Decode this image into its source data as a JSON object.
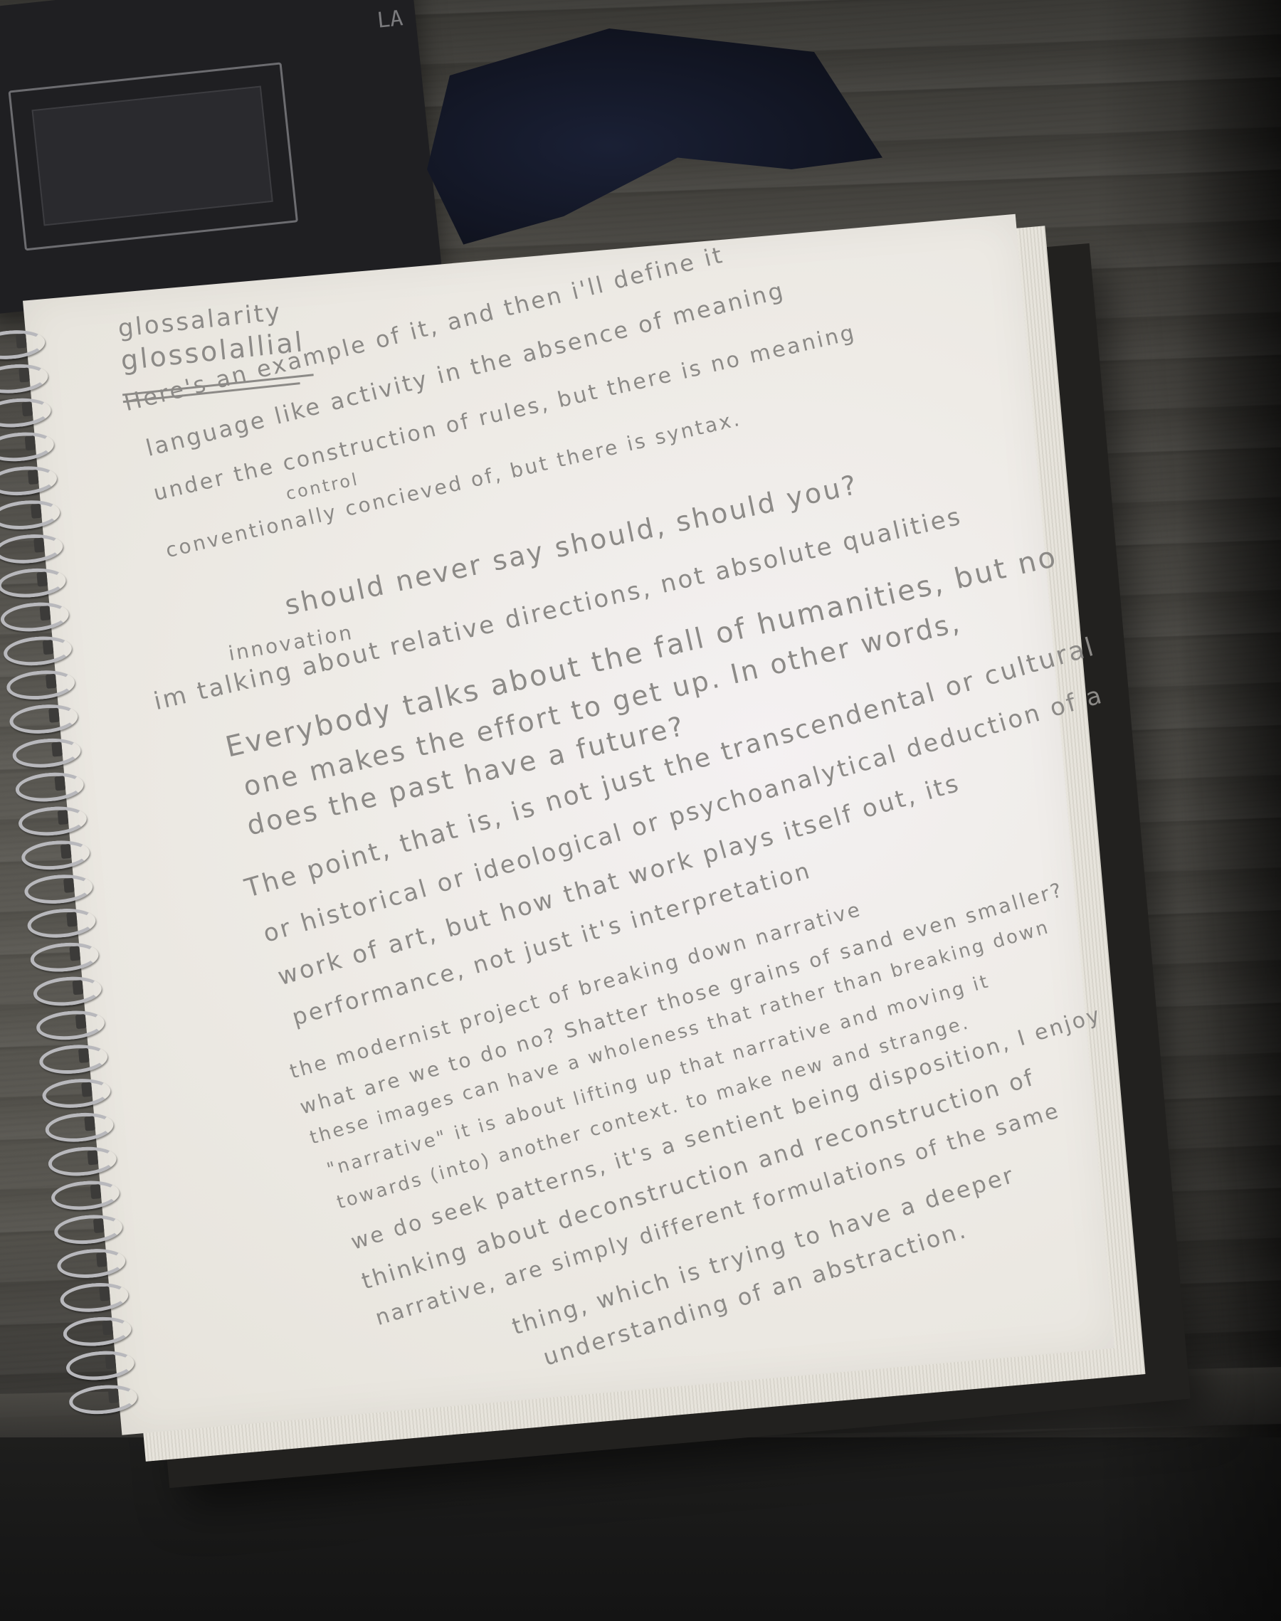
{
  "scene": {
    "description_objects": [
      "wooden-table",
      "spiral-notebook",
      "dark-cloth",
      "dark-frame"
    ],
    "frame_label": "LA"
  },
  "notes": {
    "lines": [
      "glossalarity",
      "glossolallial",
      "Here's an example of it, and then i'll define it",
      "language like activity in the absence of meaning",
      "under the construction of rules, but there is no meaning",
      "control",
      "conventionally concieved of, but there is syntax.",
      "should never say should, should you?",
      "innovation",
      "im talking about relative directions, not absolute qualities",
      "Everybody talks about the fall of humanities, but no",
      "one makes the effort to get up. In other words,",
      "does the past have a future?",
      "The point, that is, is not just the transcendental or cultural",
      "or historical or ideological or psychoanalytical deduction of a",
      "work of art, but how that work plays itself out, its",
      "performance, not just it's interpretation",
      "the modernist project of breaking down narrative",
      "what are we to do no? Shatter those grains of sand even smaller?",
      "these images can have a wholeness that rather than breaking down",
      "\"narrative\" it is about lifting up that narrative and moving it",
      "towards (into) another context. to make new and strange.",
      "we do seek patterns, it's a sentient being disposition, I enjoy",
      "thinking about deconstruction and reconstruction of",
      "narrative, are simply different formulations of the same",
      "thing, which is trying to have a deeper",
      "understanding of an abstraction."
    ]
  }
}
